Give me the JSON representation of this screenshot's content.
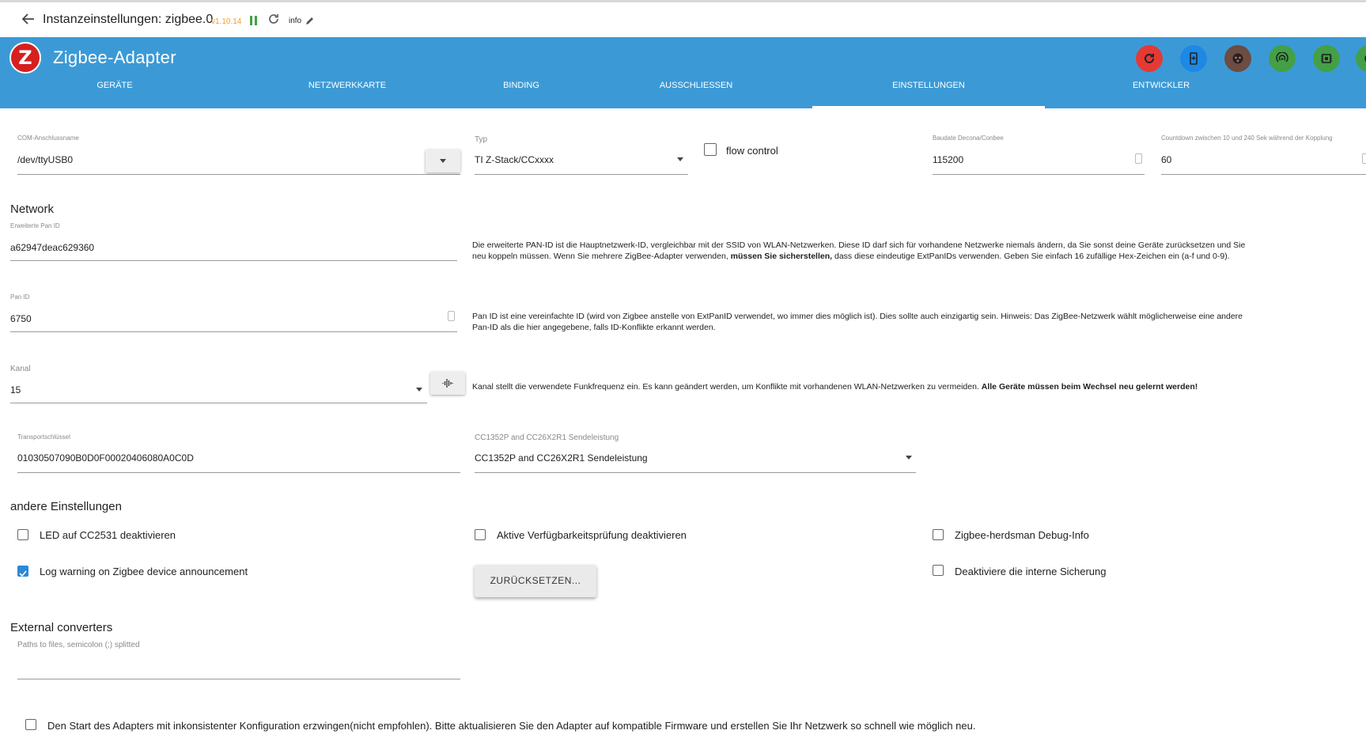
{
  "titlebar": {
    "title": "Instanzeinstellungen: zigbee.0",
    "version": "v1.10.14",
    "info_label": "info"
  },
  "header": {
    "app_title": "Zigbee-Adapter",
    "logo_letter": "Z",
    "buttons": [
      {
        "icon": "refresh-icon",
        "color": "#e53935"
      },
      {
        "icon": "device-add-icon",
        "color": "#1e88e5"
      },
      {
        "icon": "pair-icon",
        "color": "#6d4c41"
      },
      {
        "icon": "signal-icon",
        "color": "#43a047"
      },
      {
        "icon": "chip-icon",
        "color": "#43a047"
      },
      {
        "icon": "more-icon",
        "color": "#43a047"
      }
    ]
  },
  "tabs": [
    "GERÄTE",
    "NETZWERKKARTE",
    "BINDING",
    "AUSSCHLIESSEN",
    "EINSTELLUNGEN",
    "ENTWICKLER"
  ],
  "active_tab": "EINSTELLUNGEN",
  "com": {
    "label": "COM-Anschlussname",
    "value": "/dev/ttyUSB0"
  },
  "typ": {
    "label": "Typ",
    "value": "TI Z-Stack/CCxxxx"
  },
  "flow_control": {
    "label": "flow control",
    "checked": false
  },
  "baudrate": {
    "label": "Baudate Decona/Conbee",
    "value": "115200"
  },
  "countdown": {
    "label": "Countdown zwischen 10 und 240 Sek während der Kopplung",
    "value": "60"
  },
  "network": {
    "title": "Network",
    "ext_pan": {
      "label": "Erweiterte Pan ID",
      "value": "a62947deac629360",
      "desc_line1": "Die erweiterte PAN-ID ist die Hauptnetzwerk-ID, vergleichbar mit der SSID von WLAN-Netzwerken. Diese ID darf sich für vorhandene Netzwerke niemals ändern, da Sie sonst deine Geräte zurücksetzen und Sie",
      "desc_line2a": "neu koppeln müssen. Wenn Sie mehrere ZigBee-Adapter verwenden, ",
      "desc_line2b": "müssen Sie sicherstellen,",
      "desc_line2c": " dass diese eindeutige ExtPanIDs verwenden. Geben Sie einfach 16 zufällige Hex-Zeichen ein (a-f und 0-9)."
    },
    "pan_id": {
      "label": "Pan ID",
      "value": "6750",
      "desc_line1": "Pan ID ist eine vereinfachte ID (wird von Zigbee anstelle von ExtPanID verwendet, wo immer dies möglich ist). Dies sollte auch einzigartig sein. Hinweis: Das ZigBee-Netzwerk wählt möglicherweise eine andere",
      "desc_line2": "Pan-ID als die hier angegebene, falls ID-Konflikte erkannt werden."
    },
    "channel": {
      "label": "Kanal",
      "value": "15",
      "desc_a": "Kanal stellt die verwendete Funkfrequenz ein. Es kann geändert werden, um Konflikte mit vorhandenen WLAN-Netzwerken zu vermeiden. ",
      "desc_b": "Alle Geräte müssen beim Wechsel neu gelernt werden!"
    },
    "transport_key": {
      "label": "Transportschlüssel",
      "value": "01030507090B0D0F00020406080A0C0D"
    },
    "tx_power": {
      "label": "CC1352P and CC26X2R1 Sendeleistung",
      "value": "CC1352P and CC26X2R1 Sendeleistung"
    }
  },
  "other": {
    "title": "andere Einstellungen",
    "led": {
      "label": "LED auf CC2531 deaktivieren",
      "checked": false
    },
    "avail": {
      "label": "Aktive Verfügbarkeitsprüfung deaktivieren",
      "checked": false
    },
    "debug": {
      "label": "Zigbee-herdsman Debug-Info",
      "checked": false
    },
    "log_warning": {
      "label": "Log warning on Zigbee device announcement",
      "checked": true
    },
    "reset_button": "ZURÜCKSETZEN...",
    "backup": {
      "label": "Deaktiviere die interne Sicherung",
      "checked": false
    }
  },
  "converters": {
    "title": "External converters",
    "placeholder": "Paths to files, semicolon (;) splitted",
    "value": ""
  },
  "force_start": {
    "label": "Den Start des Adapters mit inkonsistenter Konfiguration erzwingen(nicht empfohlen). Bitte aktualisieren Sie den Adapter auf kompatible Firmware und erstellen Sie Ihr Netzwerk so schnell wie möglich neu.",
    "checked": false
  }
}
